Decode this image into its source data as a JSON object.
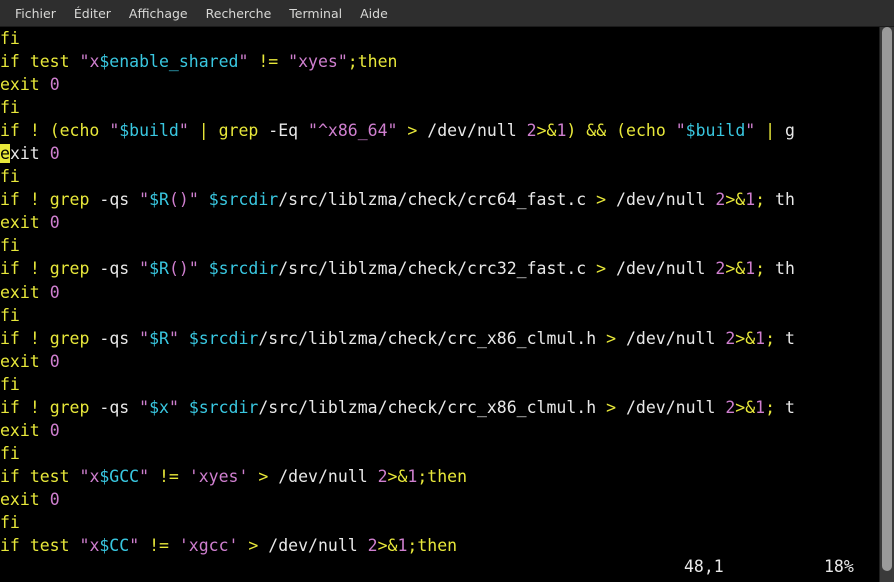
{
  "window": {
    "app": "Terminal",
    "background_color": "#000000"
  },
  "menubar": {
    "items": [
      {
        "label": "Fichier",
        "name": "menu-fichier"
      },
      {
        "label": "Éditer",
        "name": "menu-editer"
      },
      {
        "label": "Affichage",
        "name": "menu-affichage"
      },
      {
        "label": "Recherche",
        "name": "menu-recherche"
      },
      {
        "label": "Terminal",
        "name": "menu-terminal"
      },
      {
        "label": "Aide",
        "name": "menu-aide"
      }
    ]
  },
  "editor": {
    "colors": {
      "keyword": "#e8e83a",
      "string": "#cf7fcf",
      "variable": "#39c7e0",
      "number": "#cf7fcf",
      "plain": "#e8e8e8",
      "cursor": "#e8e83a",
      "background": "#000000"
    },
    "cursor": {
      "line_index": 5,
      "column_index": 0,
      "char": "e"
    },
    "lines": [
      "fi",
      "if test \"x$enable_shared\" != \"xyes\";then",
      "exit 0",
      "fi",
      "if ! (echo \"$build\" | grep -Eq \"^x86_64\" > /dev/null 2>&1) && (echo \"$build\" | g",
      "exit 0",
      "fi",
      "if ! grep -qs \"$R()\" $srcdir/src/liblzma/check/crc64_fast.c > /dev/null 2>&1; th",
      "exit 0",
      "fi",
      "if ! grep -qs \"$R()\" $srcdir/src/liblzma/check/crc32_fast.c > /dev/null 2>&1; th",
      "exit 0",
      "fi",
      "if ! grep -qs \"$R\" $srcdir/src/liblzma/check/crc_x86_clmul.h > /dev/null 2>&1; t",
      "exit 0",
      "fi",
      "if ! grep -qs \"$x\" $srcdir/src/liblzma/check/crc_x86_clmul.h > /dev/null 2>&1; t",
      "exit 0",
      "fi",
      "if test \"x$GCC\" != 'xyes' > /dev/null 2>&1;then",
      "exit 0",
      "fi",
      "if test \"x$CC\" != 'xgcc' > /dev/null 2>&1;then"
    ]
  },
  "ruler": {
    "position": "48,1",
    "percent": "18%"
  },
  "scrollbar": {
    "name": "vertical-scrollbar",
    "thumb_top_percent": 0,
    "thumb_height_percent": 98
  }
}
